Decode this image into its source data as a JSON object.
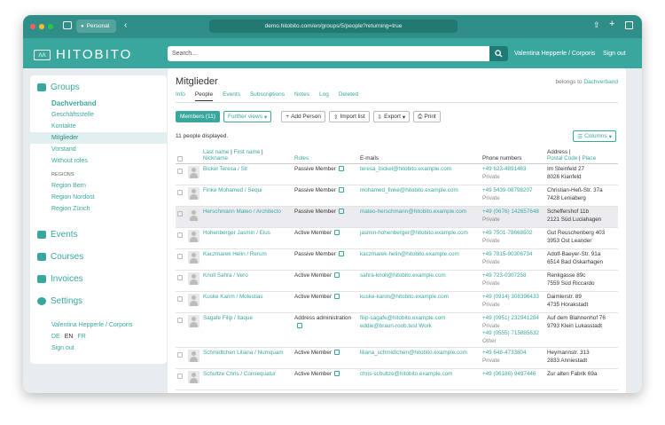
{
  "browser": {
    "tab_label": "Personal",
    "url": "demo.hitobito.com/en/groups/5/people?returning=true"
  },
  "app": {
    "logo_text": "HITOBITO",
    "search_placeholder": "Search...",
    "user_name": "Valentina Hepperle / Corporis",
    "sign_out": "Sign out"
  },
  "sidebar": {
    "groups_label": "Groups",
    "items": [
      {
        "label": "Dachverband"
      },
      {
        "label": "Geschäftsstelle"
      },
      {
        "label": "Kontakte"
      },
      {
        "label": "Mitglieder"
      },
      {
        "label": "Vorstand"
      },
      {
        "label": "Without roles"
      }
    ],
    "regions_heading": "REGIONS",
    "regions": [
      {
        "label": "Region Bern"
      },
      {
        "label": "Region Nordost"
      },
      {
        "label": "Region Zürich"
      }
    ],
    "nav": [
      {
        "label": "Events"
      },
      {
        "label": "Courses"
      },
      {
        "label": "Invoices"
      },
      {
        "label": "Settings"
      }
    ],
    "footer_user": "Valentina Hepperle / Corporis",
    "langs": [
      "DE",
      "EN",
      "FR"
    ],
    "sign_out": "Sign out"
  },
  "main": {
    "title": "Mitglieder",
    "belongs_to": "belongs to",
    "belongs_link": "Dachverband",
    "tabs": [
      {
        "label": "Info"
      },
      {
        "label": "People"
      },
      {
        "label": "Events"
      },
      {
        "label": "Subscriptions"
      },
      {
        "label": "Notes"
      },
      {
        "label": "Log"
      },
      {
        "label": "Deleted"
      }
    ],
    "buttons": {
      "members": "Members (11)",
      "further_views": "Further views",
      "add_person": "Add Person",
      "import_list": "Import list",
      "export": "Export",
      "print": "Print",
      "columns": "Columns"
    },
    "people_count": "11 people displayed.",
    "columns": {
      "last_name": "Last name",
      "first_name": "First name",
      "nickname": "Nickname",
      "roles": "Roles",
      "emails": "E-mails",
      "phone": "Phone numbers",
      "address": "Address",
      "postal_code": "Postal Code",
      "place": "Place"
    },
    "rows": [
      {
        "name": "Bickel Teresa / Sit",
        "role": "Passive Member",
        "email": "teresa_bickel@hitobito.example.com",
        "email2": "",
        "phone": "+49 623-4891463",
        "phone_type": "Private",
        "phone2": "",
        "phone2_type": "",
        "addr1": "Im Steinfeld 27",
        "addr2": "8026 Kianfeld"
      },
      {
        "name": "Finke Mohamed / Sequi",
        "role": "Passive Member",
        "email": "mohamed_finke@hitobito.example.com",
        "email2": "",
        "phone": "+49 5439-08798207",
        "phone_type": "Private",
        "phone2": "",
        "phone2_type": "",
        "addr1": "Christian-Heß-Str. 37a",
        "addr2": "7428 Leniaberg"
      },
      {
        "name": "Herschmann Mateo / Architecto",
        "role": "Passive Member",
        "email": "mateo-herschmann@hitobito.example.com",
        "email2": "",
        "phone": "+49 (0676) 142657648",
        "phone_type": "Private",
        "phone2": "",
        "phone2_type": "",
        "addr1": "Scheffershof 11b",
        "addr2": "2121 Süd Luciahagen"
      },
      {
        "name": "Hohenberger Jasmin / Eius",
        "role": "Active Member",
        "email": "jasmin-hohenberger@hitobito.example.com",
        "email2": "",
        "phone": "+49 7501-78668502",
        "phone_type": "Private",
        "phone2": "",
        "phone2_type": "",
        "addr1": "Gut Reuschenberg 403",
        "addr2": "3953 Ost Leander"
      },
      {
        "name": "Kaczmarek Helin / Rerum",
        "role": "Passive Member",
        "email": "kaczmarek-helin@hitobito.example.com",
        "email2": "",
        "phone": "+49 7815-90306734",
        "phone_type": "Private",
        "phone2": "",
        "phone2_type": "",
        "addr1": "Adolf-Baeyer-Str. 91a",
        "addr2": "6514 Bad Oskarhagen"
      },
      {
        "name": "Knoll Sahra / Vero",
        "role": "Active Member",
        "email": "sahra-knoll@hitobito.example.com",
        "email2": "",
        "phone": "+49 723-0307258",
        "phone_type": "Private",
        "phone2": "",
        "phone2_type": "",
        "addr1": "Renkgasse 89c",
        "addr2": "7559 Süd Riccardo"
      },
      {
        "name": "Kuske Karim / Molestias",
        "role": "Active Member",
        "email": "kuske-karim@hitobito.example.com",
        "email2": "",
        "phone": "+49 (0914) 308396433",
        "phone_type": "Private",
        "phone2": "",
        "phone2_type": "",
        "addr1": "Daimlerstr. 89",
        "addr2": "4735 Horakstadt"
      },
      {
        "name": "Sagafe Filip / Itaque",
        "role": "Address administration",
        "email": "filip-sagafe@hitobito.example.com",
        "email2": "eddie@braun-roob.test Work",
        "phone": "+49 (0951) 232941284",
        "phone_type": "Private",
        "phone2": "+49 (0555) 715885632",
        "phone2_type": "Other",
        "addr1": "Auf dem Blahnenhof 76",
        "addr2": "9793 Klein Lukasstadt"
      },
      {
        "name": "Schmidtchen Liliana / Numquam",
        "role": "Active Member",
        "email": "liliana_schmidtchen@hitobito.example.com",
        "email2": "",
        "phone": "+49 648-4733804",
        "phone_type": "Private",
        "phone2": "",
        "phone2_type": "",
        "addr1": "Heymannstr. 313",
        "addr2": "2833 Anniestadt"
      },
      {
        "name": "Schultze Chris / Consequatur",
        "role": "Active Member",
        "email": "chris-schultze@hitobito.example.com",
        "email2": "",
        "phone": "+49 (06186) 9497446",
        "phone_type": "",
        "phone2": "",
        "phone2_type": "",
        "addr1": "Zur alten Fabrik 69a",
        "addr2": ""
      }
    ]
  }
}
